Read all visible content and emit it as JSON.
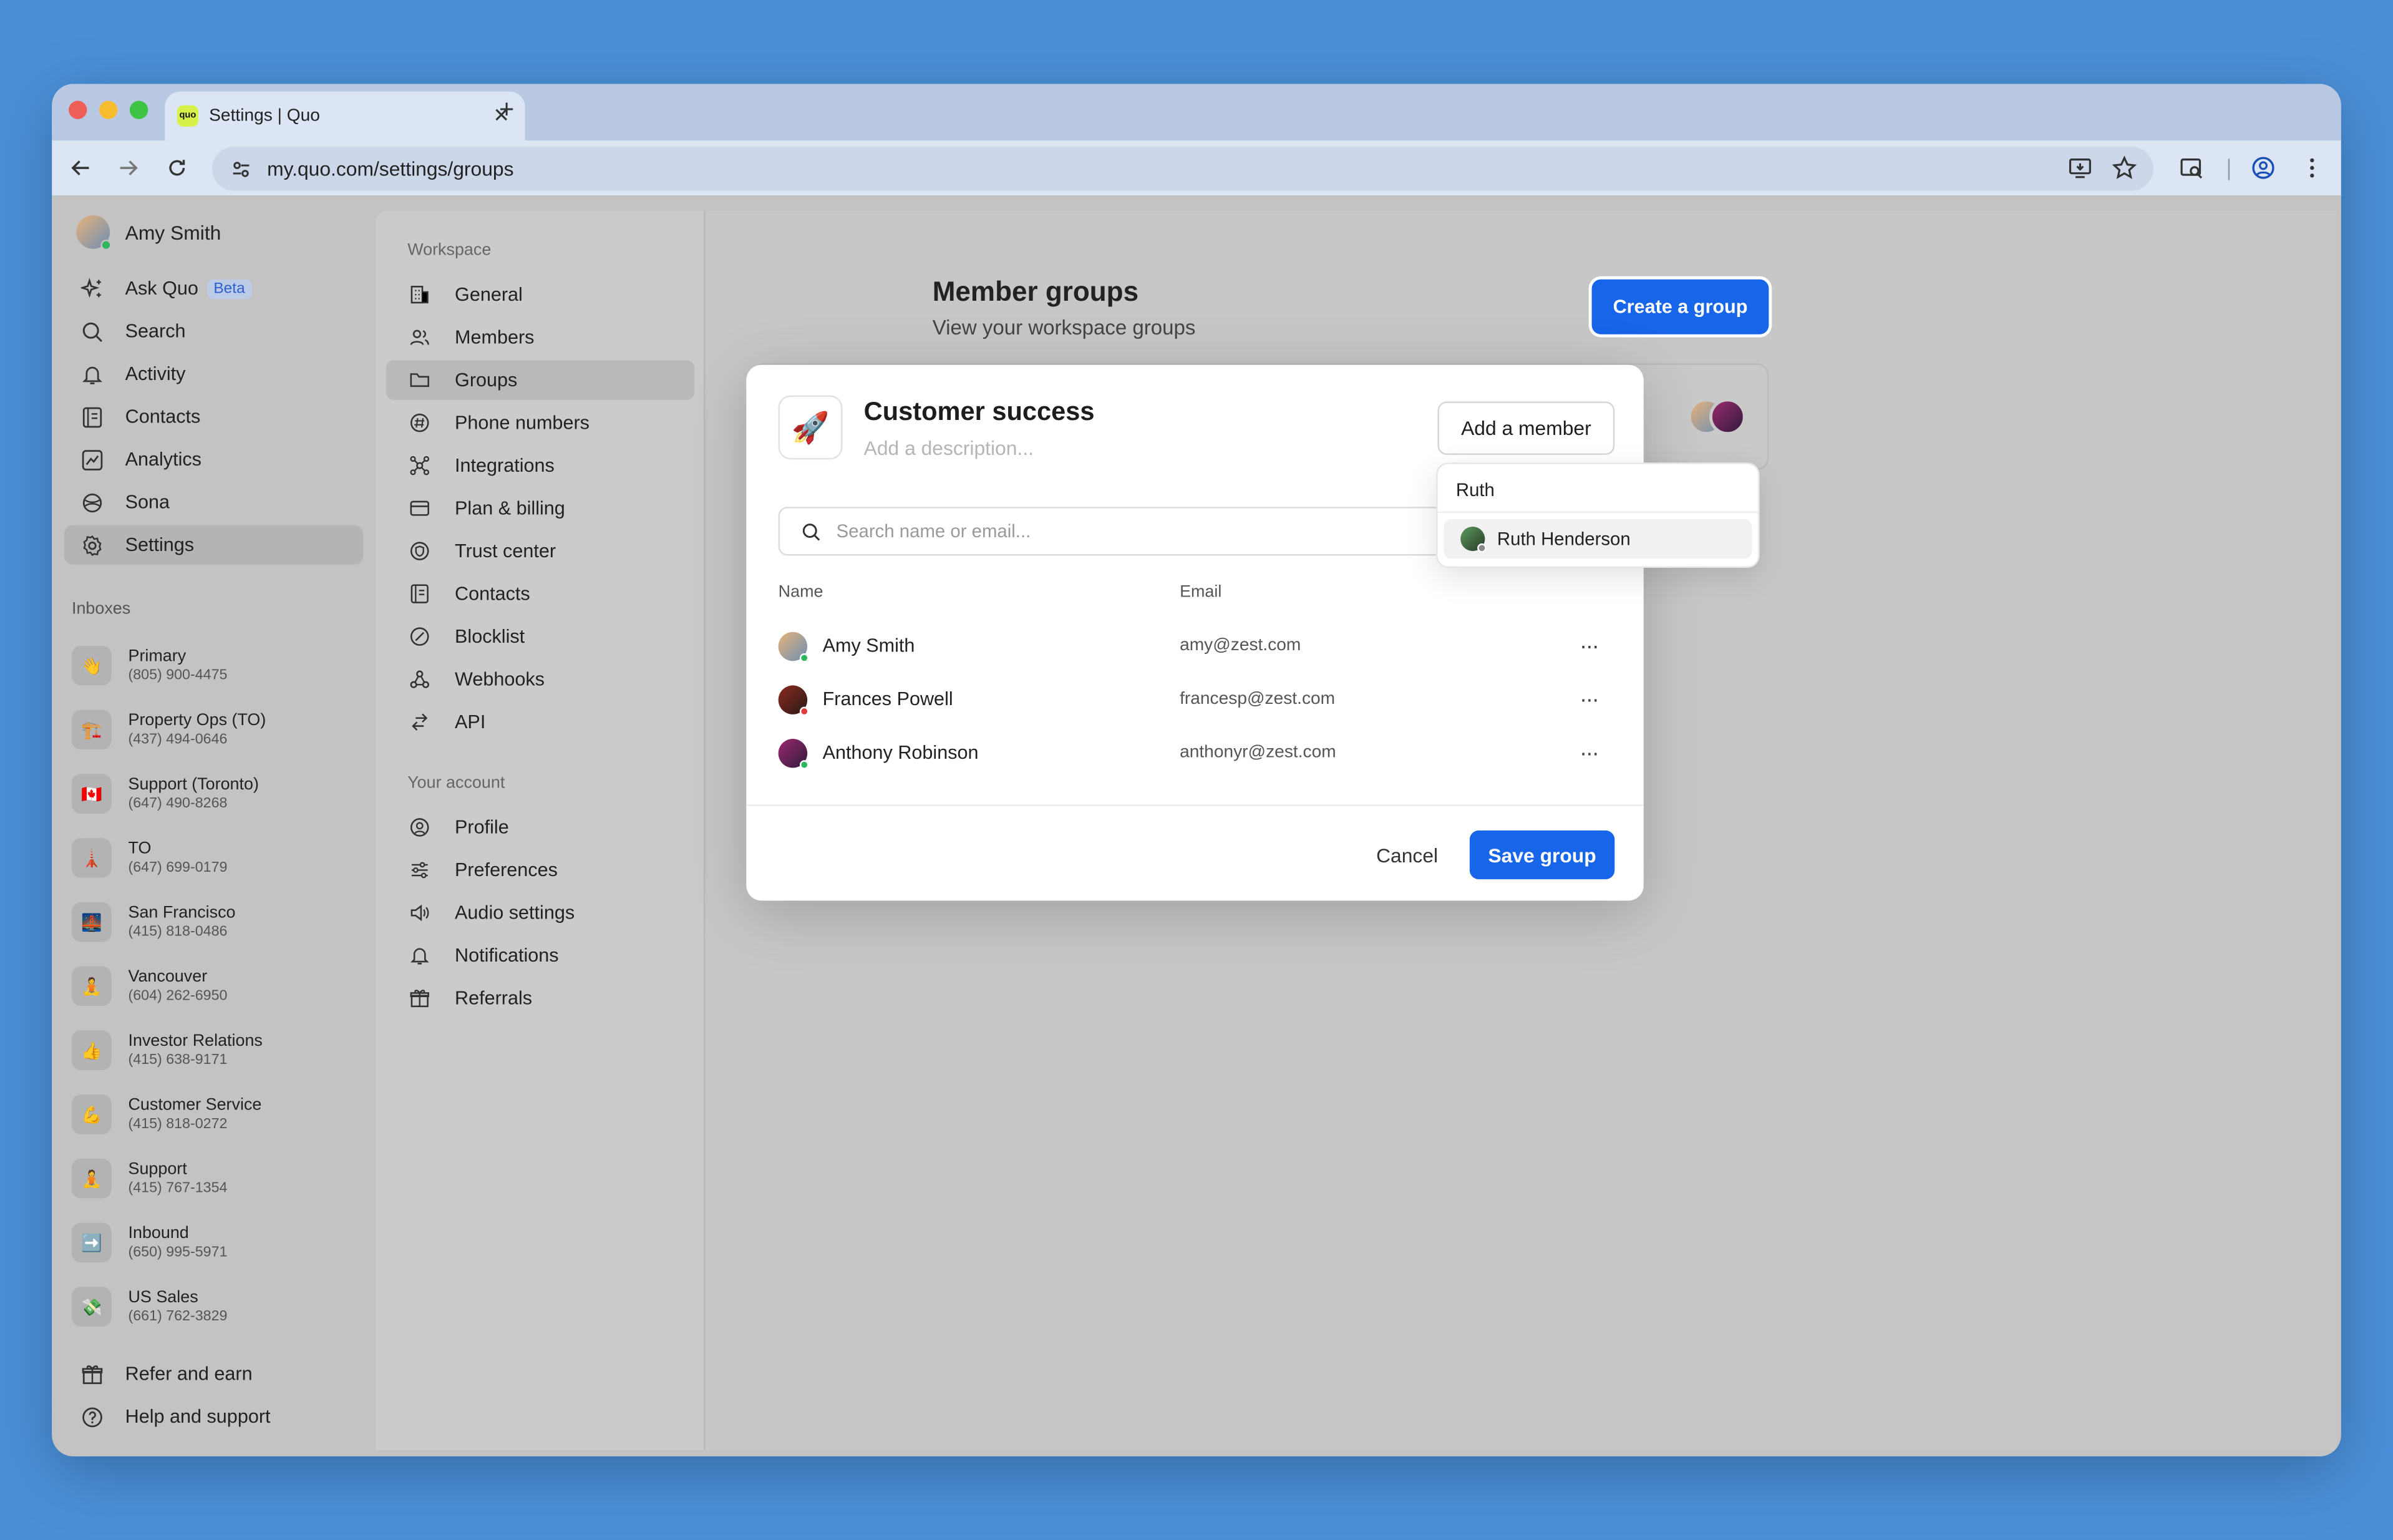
{
  "browser": {
    "tab_title": "Settings | Quo",
    "favicon_text": "quo",
    "url": "my.quo.com/settings/groups",
    "new_tab": "+",
    "close": "✕"
  },
  "sidebar": {
    "user_name": "Amy Smith",
    "nav": [
      {
        "label": "Ask Quo",
        "icon": "sparkle-icon",
        "badge": "Beta"
      },
      {
        "label": "Search",
        "icon": "search-icon"
      },
      {
        "label": "Activity",
        "icon": "bell-icon"
      },
      {
        "label": "Contacts",
        "icon": "contacts-icon"
      },
      {
        "label": "Analytics",
        "icon": "analytics-icon"
      },
      {
        "label": "Sona",
        "icon": "sona-icon"
      },
      {
        "label": "Settings",
        "icon": "gear-icon",
        "active": true
      }
    ],
    "inboxes_label": "Inboxes",
    "inboxes": [
      {
        "name": "Primary",
        "phone": "(805) 900-4475",
        "emoji": "👋"
      },
      {
        "name": "Property Ops (TO)",
        "phone": "(437) 494-0646",
        "emoji": "🏗️"
      },
      {
        "name": "Support (Toronto)",
        "phone": "(647) 490-8268",
        "emoji": "🇨🇦"
      },
      {
        "name": "TO",
        "phone": "(647) 699-0179",
        "emoji": "🗼"
      },
      {
        "name": "San Francisco",
        "phone": "(415) 818-0486",
        "emoji": "🌉"
      },
      {
        "name": "Vancouver",
        "phone": "(604) 262-6950",
        "emoji": "🧘"
      },
      {
        "name": "Investor Relations",
        "phone": "(415) 638-9171",
        "emoji": "👍"
      },
      {
        "name": "Customer Service",
        "phone": "(415) 818-0272",
        "emoji": "💪"
      },
      {
        "name": "Support",
        "phone": "(415) 767-1354",
        "emoji": "🧘"
      },
      {
        "name": "Inbound",
        "phone": "(650) 995-5971",
        "emoji": "➡️"
      },
      {
        "name": "US Sales",
        "phone": "(661) 762-3829",
        "emoji": "💸"
      }
    ],
    "refer_label": "Refer and earn",
    "help_label": "Help and support"
  },
  "settings_nav": {
    "workspace_label": "Workspace",
    "workspace_items": [
      {
        "label": "General",
        "icon": "building-icon"
      },
      {
        "label": "Members",
        "icon": "members-icon"
      },
      {
        "label": "Groups",
        "icon": "folder-icon",
        "active": true
      },
      {
        "label": "Phone numbers",
        "icon": "hash-icon"
      },
      {
        "label": "Integrations",
        "icon": "integrations-icon"
      },
      {
        "label": "Plan & billing",
        "icon": "credit-card-icon"
      },
      {
        "label": "Trust center",
        "icon": "shield-icon"
      },
      {
        "label": "Contacts",
        "icon": "contacts-icon"
      },
      {
        "label": "Blocklist",
        "icon": "block-icon"
      },
      {
        "label": "Webhooks",
        "icon": "webhook-icon"
      },
      {
        "label": "API",
        "icon": "api-icon"
      }
    ],
    "account_label": "Your account",
    "account_items": [
      {
        "label": "Profile",
        "icon": "profile-icon"
      },
      {
        "label": "Preferences",
        "icon": "sliders-icon"
      },
      {
        "label": "Audio settings",
        "icon": "speaker-icon"
      },
      {
        "label": "Notifications",
        "icon": "bell-icon"
      },
      {
        "label": "Referrals",
        "icon": "gift-icon"
      }
    ]
  },
  "main": {
    "title": "Member groups",
    "subtitle": "View your workspace groups",
    "create_button": "Create a group"
  },
  "modal": {
    "group_emoji": "🚀",
    "group_name": "Customer success",
    "description_placeholder": "Add a description...",
    "add_member_button": "Add a member",
    "search_placeholder": "Search name or email...",
    "columns": {
      "name": "Name",
      "email": "Email"
    },
    "members": [
      {
        "name": "Amy Smith",
        "email": "amy@zest.com",
        "more": "···"
      },
      {
        "name": "Frances Powell",
        "email": "francesp@zest.com",
        "more": "···"
      },
      {
        "name": "Anthony Robinson",
        "email": "anthonyr@zest.com",
        "more": "···"
      }
    ],
    "cancel_button": "Cancel",
    "save_button": "Save group"
  },
  "dropdown": {
    "query": "Ruth",
    "results": [
      {
        "name": "Ruth Henderson"
      }
    ]
  }
}
